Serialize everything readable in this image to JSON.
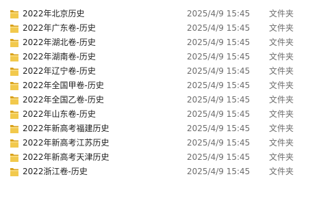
{
  "file_list": {
    "items": [
      {
        "name": "2022年北京历史",
        "modified": "2025/4/9 15:45",
        "type": "文件夹",
        "icon": "folder-icon"
      },
      {
        "name": "2022年广东卷-历史",
        "modified": "2025/4/9 15:45",
        "type": "文件夹",
        "icon": "folder-icon"
      },
      {
        "name": "2022年湖北卷-历史",
        "modified": "2025/4/9 15:45",
        "type": "文件夹",
        "icon": "folder-icon"
      },
      {
        "name": "2022年湖南卷-历史",
        "modified": "2025/4/9 15:45",
        "type": "文件夹",
        "icon": "folder-icon"
      },
      {
        "name": "2022年辽宁卷-历史",
        "modified": "2025/4/9 15:45",
        "type": "文件夹",
        "icon": "folder-icon"
      },
      {
        "name": "2022年全国甲卷-历史",
        "modified": "2025/4/9 15:45",
        "type": "文件夹",
        "icon": "folder-icon"
      },
      {
        "name": "2022年全国乙卷-历史",
        "modified": "2025/4/9 15:45",
        "type": "文件夹",
        "icon": "folder-icon"
      },
      {
        "name": "2022年山东卷-历史",
        "modified": "2025/4/9 15:45",
        "type": "文件夹",
        "icon": "folder-icon"
      },
      {
        "name": "2022年新高考福建历史",
        "modified": "2025/4/9 15:45",
        "type": "文件夹",
        "icon": "folder-icon"
      },
      {
        "name": "2022年新高考江苏历史",
        "modified": "2025/4/9 15:45",
        "type": "文件夹",
        "icon": "folder-icon"
      },
      {
        "name": "2022年新高考天津历史",
        "modified": "2025/4/9 15:45",
        "type": "文件夹",
        "icon": "folder-icon"
      },
      {
        "name": "2022浙江卷-历史",
        "modified": "2025/4/9 15:45",
        "type": "文件夹",
        "icon": "folder-icon"
      }
    ]
  },
  "colors": {
    "folder_front": "#f2c94c",
    "folder_back": "#d9a21b",
    "folder_highlight": "#f9df8a",
    "text": "#1e1e1e",
    "secondary_text": "#6d6d6d"
  }
}
